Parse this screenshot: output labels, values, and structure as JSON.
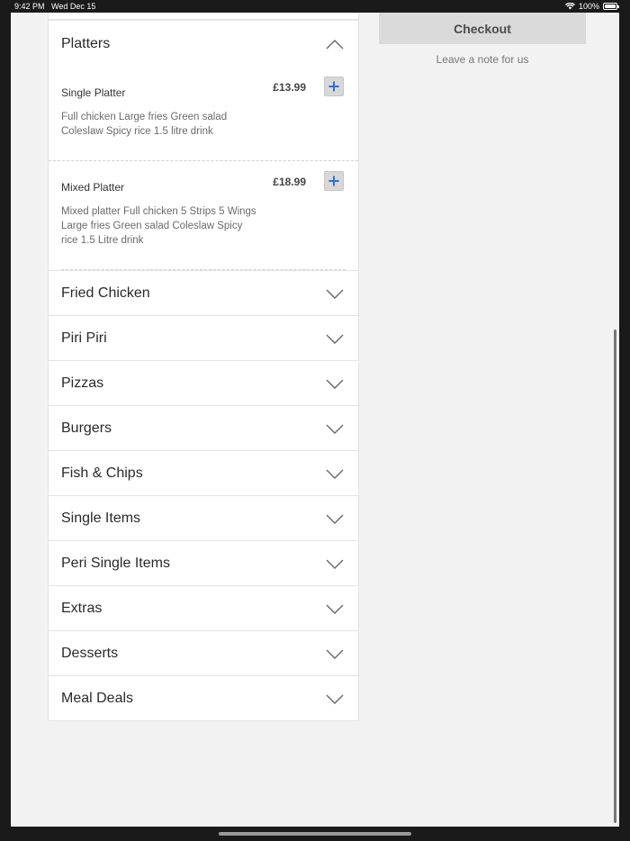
{
  "status_bar": {
    "time": "9:42 PM",
    "date": "Wed Dec 15",
    "battery": "100%"
  },
  "cart": {
    "checkout_label": "Checkout",
    "note_label": "Leave a note for us"
  },
  "menu": {
    "open_section": {
      "title": "Platters",
      "items": [
        {
          "name": "Single Platter",
          "price": "£13.99",
          "description": "Full chicken Large fries Green salad Coleslaw Spicy rice 1.5 litre drink"
        },
        {
          "name": "Mixed Platter",
          "price": "£18.99",
          "description": "Mixed platter Full chicken 5 Strips 5 Wings Large fries Green salad Coleslaw Spicy rice 1.5 Litre drink"
        }
      ]
    },
    "sections": [
      "Fried Chicken",
      "Piri Piri",
      "Pizzas",
      "Burgers",
      "Fish & Chips",
      "Single Items",
      "Peri Single Items",
      "Extras",
      "Desserts",
      "Meal Deals"
    ]
  },
  "colors": {
    "accent": "#2f6fcf",
    "background": "#f2f2f2",
    "card": "#ffffff",
    "button": "#dadada"
  }
}
